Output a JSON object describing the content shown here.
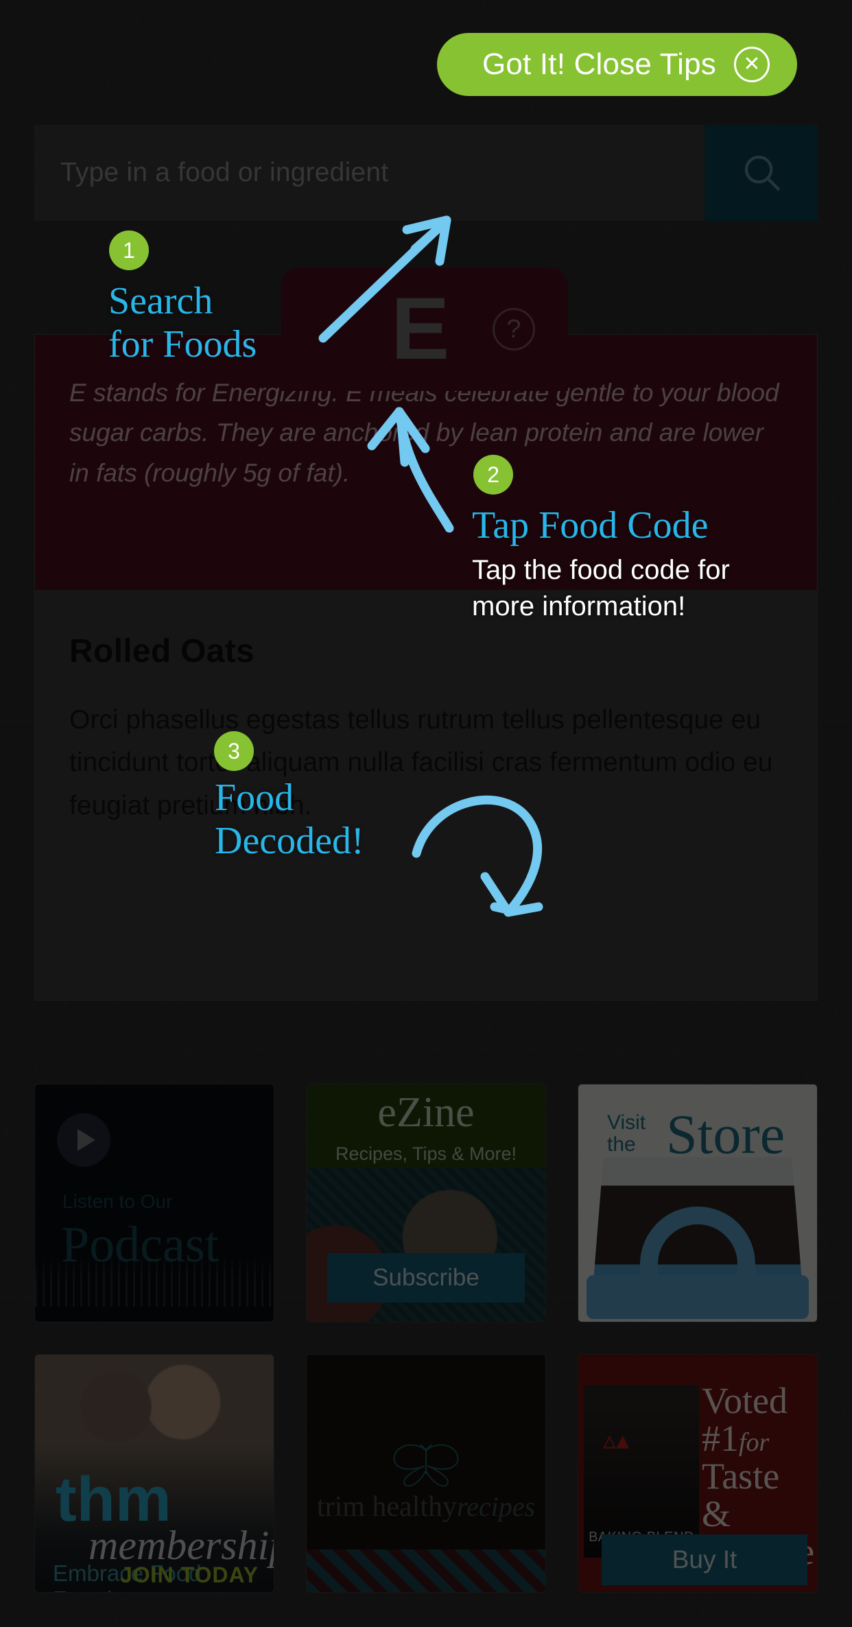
{
  "overlay": {
    "close_tips_label": "Got It! Close Tips",
    "close_icon": "close-x-icon"
  },
  "search": {
    "placeholder": "Type in a food or ingredient",
    "value": "",
    "button_icon": "search-icon",
    "button_color": "#0d4353"
  },
  "food_code_card": {
    "letter": "E",
    "help_icon": "question-mark-icon",
    "card_color": "#4a1020"
  },
  "detail": {
    "description": "E stands for Energizing. E meals celebrate gentle to your blood sugar carbs. They are anchored by lean protein and are lower in fats (roughly 5g of fat).",
    "food_title": "Rolled Oats",
    "food_paragraph": "Orci phasellus egestas tellus rutrum tellus pellentesque eu tincidunt tortor aliquam nulla facilisi cras fermentum odio eu feugiat pretium nibh."
  },
  "tips": [
    {
      "number": "1",
      "title": "Search\nfor Foods",
      "subtitle": ""
    },
    {
      "number": "2",
      "title": "Tap Food Code",
      "subtitle": "Tap the food code for more information!"
    },
    {
      "number": "3",
      "title": "Food\nDecoded!",
      "subtitle": ""
    }
  ],
  "tip_colors": {
    "badge": "#86c232",
    "title": "#29b6e8",
    "arrow": "#74c9f0"
  },
  "promos": [
    {
      "name": "podcast",
      "icon": "play-icon",
      "eyebrow": "Listen to Our",
      "title": "Podcast"
    },
    {
      "name": "ezine",
      "title": "eZine",
      "subtitle": "Recipes, Tips & More!",
      "cta": "Subscribe"
    },
    {
      "name": "store",
      "eyebrow": "Visit",
      "eyebrow2": "the",
      "title": "Store"
    },
    {
      "name": "thm-membership",
      "logo": "thm",
      "title": "membership",
      "subtitle": "Embrace Food Freedom",
      "cta": "JOIN TODAY"
    },
    {
      "name": "trim-healthy-recipes",
      "icon": "butterfly-icon",
      "title": "trim healthy",
      "title_italic": "recipes"
    },
    {
      "name": "baking-blend",
      "headline_1": "Voted",
      "headline_2": "#1",
      "headline_2_italic": "for",
      "headline_3": "Taste &",
      "headline_4": "Texture",
      "product_label": "BAKING BLEND",
      "cta": "Buy It"
    }
  ]
}
